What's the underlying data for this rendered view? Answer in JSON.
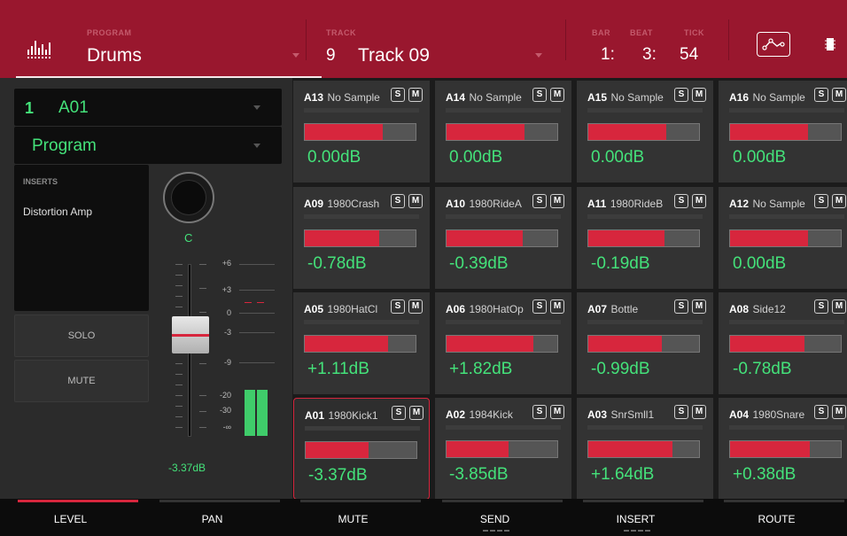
{
  "header": {
    "program_label": "PROGRAM",
    "program_value": "Drums",
    "track_label": "TRACK",
    "track_number": "9",
    "track_name": "Track 09",
    "bar_label": "BAR",
    "beat_label": "BEAT",
    "tick_label": "TICK",
    "bar_value": "1:",
    "beat_value": "3:",
    "tick_value": "54",
    "icons": [
      "waveform-logo-icon",
      "automation-curve-icon",
      "chip-icon"
    ]
  },
  "left": {
    "pad_number": "1",
    "pad_name": "A01",
    "type_value": "Program",
    "inserts_title": "INSERTS",
    "inserts_item": "Distortion Amp",
    "pan_value": "C",
    "solo_label": "SOLO",
    "mute_label": "MUTE",
    "level_readout": "-3.37dB",
    "fader_scale": [
      "+6",
      "+3",
      "0",
      "-3",
      "-9",
      "-20",
      "-30",
      "-∞"
    ]
  },
  "pads": [
    {
      "id": "A13",
      "name": "No Sample",
      "db": "0.00dB",
      "level": 0.7
    },
    {
      "id": "A14",
      "name": "No Sample",
      "db": "0.00dB",
      "level": 0.7
    },
    {
      "id": "A15",
      "name": "No Sample",
      "db": "0.00dB",
      "level": 0.7
    },
    {
      "id": "A16",
      "name": "No Sample",
      "db": "0.00dB",
      "level": 0.7
    },
    {
      "id": "A09",
      "name": "1980Crash",
      "db": "-0.78dB",
      "level": 0.67
    },
    {
      "id": "A10",
      "name": "1980RideA",
      "db": "-0.39dB",
      "level": 0.69
    },
    {
      "id": "A11",
      "name": "1980RideB",
      "db": "-0.19dB",
      "level": 0.69
    },
    {
      "id": "A12",
      "name": "No Sample",
      "db": "0.00dB",
      "level": 0.7
    },
    {
      "id": "A05",
      "name": "1980HatCl",
      "db": "+1.11dB",
      "level": 0.75
    },
    {
      "id": "A06",
      "name": "1980HatOp",
      "db": "+1.82dB",
      "level": 0.78
    },
    {
      "id": "A07",
      "name": "Bottle",
      "db": "-0.99dB",
      "level": 0.66
    },
    {
      "id": "A08",
      "name": "Side12",
      "db": "-0.78dB",
      "level": 0.67
    },
    {
      "id": "A01",
      "name": "1980Kick1",
      "db": "-3.37dB",
      "level": 0.57,
      "selected": true
    },
    {
      "id": "A02",
      "name": "1984Kick",
      "db": "-3.85dB",
      "level": 0.56
    },
    {
      "id": "A03",
      "name": "SnrSmll1",
      "db": "+1.64dB",
      "level": 0.76
    },
    {
      "id": "A04",
      "name": "1980Snare",
      "db": "+0.38dB",
      "level": 0.72
    }
  ],
  "solo_button_label": "S",
  "mute_button_label": "M",
  "tabs": [
    {
      "label": "LEVEL",
      "active": true,
      "dots": false
    },
    {
      "label": "PAN",
      "active": false,
      "dots": false
    },
    {
      "label": "MUTE",
      "active": false,
      "dots": false
    },
    {
      "label": "SEND",
      "active": false,
      "dots": true
    },
    {
      "label": "INSERT",
      "active": false,
      "dots": true
    },
    {
      "label": "ROUTE",
      "active": false,
      "dots": false
    }
  ],
  "colors": {
    "header_red": "#99172e",
    "accent_red": "#d7263d",
    "value_green": "#44e27a"
  }
}
